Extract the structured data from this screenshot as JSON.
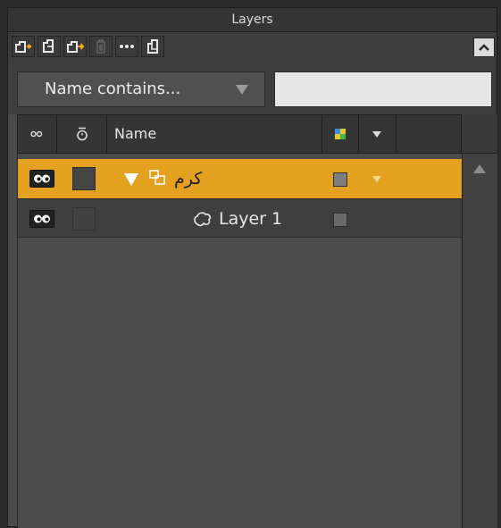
{
  "panel": {
    "title": "Layers"
  },
  "toolbar": {
    "buttons": [
      {
        "name": "new-layer-icon",
        "enabled": true
      },
      {
        "name": "duplicate-layer-icon",
        "enabled": true
      },
      {
        "name": "move-layer-icon",
        "enabled": true
      },
      {
        "name": "delete-icon",
        "enabled": false
      },
      {
        "name": "more-icon",
        "enabled": true
      },
      {
        "name": "merge-icon",
        "enabled": true
      }
    ],
    "collapse_icon": "chevron-up-icon"
  },
  "filter": {
    "select_label": "Name contains...",
    "search_value": ""
  },
  "columns": {
    "name_label": "Name"
  },
  "layers": [
    {
      "name": "كرم",
      "type": "group",
      "expanded": true,
      "selected": true,
      "visible": true
    },
    {
      "name": "Layer 1",
      "type": "vector",
      "expanded": false,
      "selected": false,
      "visible": true
    }
  ],
  "colors": {
    "selection": "#e3a11f",
    "panel_bg": "#4a4a4a",
    "row_bg": "#3f3f3f"
  }
}
